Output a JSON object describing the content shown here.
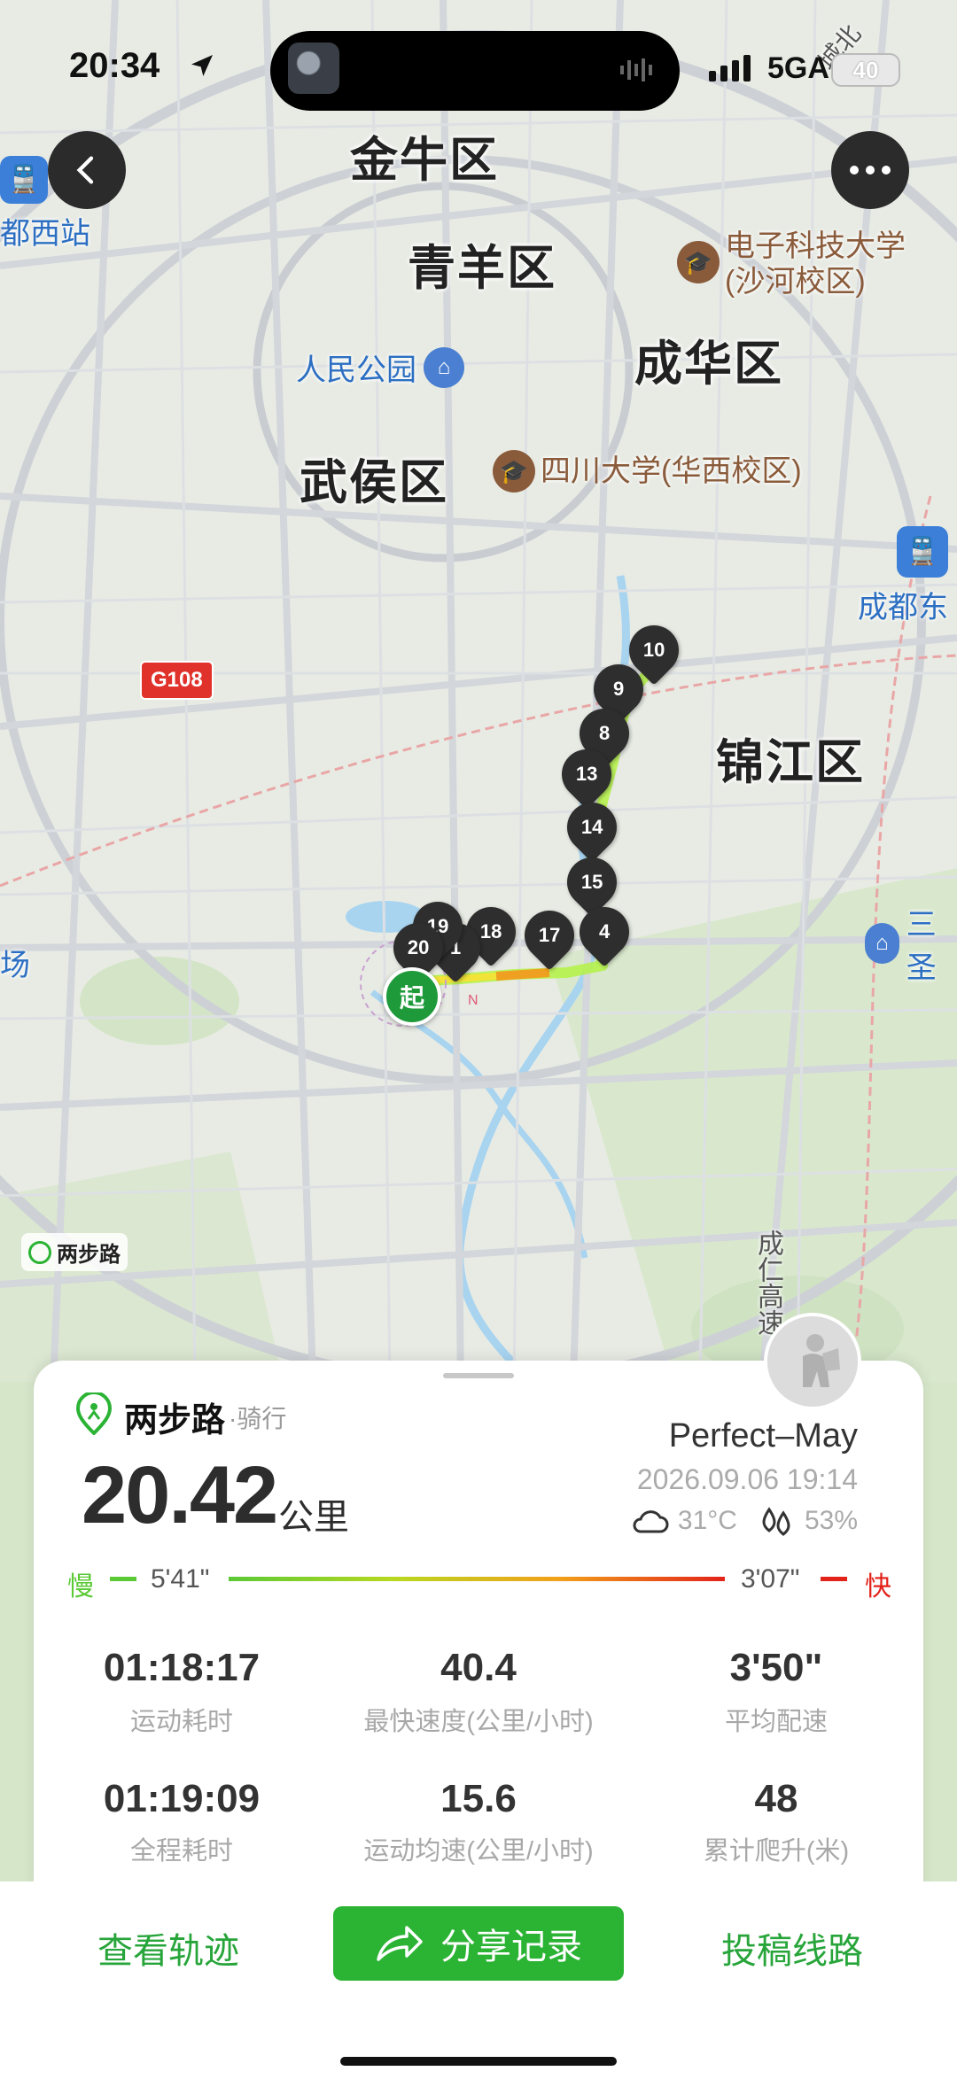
{
  "status_bar": {
    "time": "20:34",
    "network": "5GA",
    "battery": "40"
  },
  "map": {
    "districts": [
      "金牛区",
      "青羊区",
      "成华区",
      "武侯区",
      "锦江区"
    ],
    "pois": {
      "univ1": "电子科技大学\n(沙河校区)",
      "univ2": "四川大学(华西校区)",
      "park": "人民公园",
      "station_west": "都西站",
      "station_east": "成都东",
      "road_sign": "G108",
      "airport_fragment": "场",
      "sanse": "三圣",
      "highway_vertical": "成仁高速",
      "road_ne": "城北"
    },
    "watermark": "两步路",
    "start_label": "起",
    "km_markers": [
      "10",
      "9",
      "8",
      "13",
      "14",
      "15",
      "4",
      "17",
      "18",
      "1",
      "19",
      "20"
    ]
  },
  "card": {
    "brand": "两步路",
    "activity_type": "·骑行",
    "distance": "20.42",
    "distance_unit": "公里",
    "username": "Perfect–May",
    "datetime": "2026.09.06 19:14",
    "temperature": "31°C",
    "humidity": "53%",
    "pace_slow_label": "慢",
    "pace_slow_value": "5'41\"",
    "pace_fast_value": "3'07\"",
    "pace_fast_label": "快",
    "stats": [
      {
        "value": "01:18:17",
        "label": "运动耗时"
      },
      {
        "value": "40.4",
        "label": "最快速度(公里/小时)"
      },
      {
        "value": "3'50\"",
        "label": "平均配速"
      },
      {
        "value": "01:19:09",
        "label": "全程耗时"
      },
      {
        "value": "15.6",
        "label": "运动均速(公里/小时)"
      },
      {
        "value": "48",
        "label": "累计爬升(米)"
      }
    ]
  },
  "footer": {
    "view_track": "查看轨迹",
    "share": "分享记录",
    "submit_route": "投稿线路"
  },
  "colors": {
    "brand_green": "#2bb334",
    "slow": "#5ac935",
    "fast": "#e2231a"
  }
}
